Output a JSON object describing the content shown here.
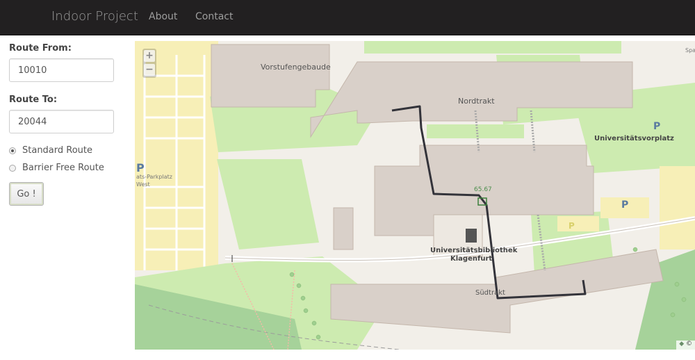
{
  "navbar": {
    "brand": "Indoor Project",
    "links": [
      "About",
      "Contact"
    ]
  },
  "form": {
    "route_from_label": "Route From:",
    "route_from_value": "10010",
    "route_to_label": "Route To:",
    "route_to_value": "20044",
    "route_options": [
      {
        "label": "Standard Route",
        "checked": true
      },
      {
        "label": "Barrier Free Route",
        "checked": false
      }
    ],
    "go_label": "Go !"
  },
  "map": {
    "zoom_in": "+",
    "zoom_out": "−",
    "labels": {
      "building_1": "Vorstufengebaude",
      "building_2": "Nordtrakt",
      "building_3": "Südtrakt",
      "room": "65.67",
      "library_line1": "Universitätsbibliothek",
      "library_line2": "Klagenfurt",
      "square": "Universitätsvorplatz",
      "parking_partial_1": "ats-Parkplatz",
      "parking_partial_2": "West",
      "corner_partial": "Spa",
      "parking_symbol": "P"
    },
    "attribution": "©",
    "colors": {
      "background": "#f2efe9",
      "grass": "#cdebb0",
      "building": "#d9d0c9",
      "parking_area": "#f7efb7",
      "route_line": "#33333a",
      "footway": "#f6b8a8"
    }
  }
}
